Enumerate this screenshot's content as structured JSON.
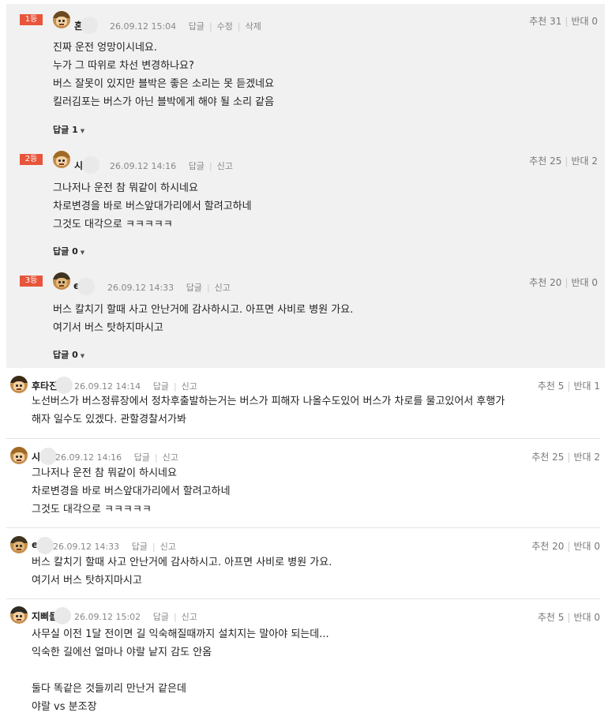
{
  "best_comments": [
    {
      "rank": "1등",
      "nick": "혼",
      "date": "26.09.12 15:04",
      "actions": [
        "답글",
        "수정",
        "삭제"
      ],
      "recommend": "추천 31",
      "oppose": "반대 0",
      "lines": [
        "진짜 운전 엉망이시네요.",
        "누가 그 따위로 차선 변경하나요?",
        "버스 잘못이 있지만 블박은 좋은 소리는 못 듣겠네요",
        "킬러김포는 버스가 아닌 블박에게 해야 될 소리 같음"
      ],
      "reply": "답글 1"
    },
    {
      "rank": "2등",
      "nick": "시",
      "date": "26.09.12 14:16",
      "actions": [
        "답글",
        "신고"
      ],
      "recommend": "추천 25",
      "oppose": "반대 2",
      "lines": [
        "그나저나 운전 참 뭐같이 하시네요",
        "차로변경을 바로 버스앞대가리에서 할려고하네",
        "그것도 대각으로 ㅋㅋㅋㅋㅋ"
      ],
      "reply": "답글 0"
    },
    {
      "rank": "3등",
      "nick": "e",
      "date": "26.09.12 14:33",
      "actions": [
        "답글",
        "신고"
      ],
      "recommend": "추천 20",
      "oppose": "반대 0",
      "lines": [
        "버스 칼치기 할때 사고 안난거에 감사하시고. 아프면 사비로 병원 가요.",
        "여기서 버스 탓하지마시고"
      ],
      "reply": "답글 0"
    }
  ],
  "comments": [
    {
      "nick": "후타진",
      "date": "26.09.12 14:14",
      "actions": [
        "답글",
        "신고"
      ],
      "recommend": "추천 5",
      "oppose": "반대 1",
      "lines": [
        "노선버스가 버스정류장에서 정차후출발하는거는 버스가 피해자 나올수도있어 버스가 차로를 물고있어서 후행가",
        "해자 일수도 있겠다. 관할경찰서가봐"
      ]
    },
    {
      "nick": "시",
      "date": "26.09.12 14:16",
      "actions": [
        "답글",
        "신고"
      ],
      "recommend": "추천 25",
      "oppose": "반대 2",
      "lines": [
        "그나저나 운전 참 뭐같이 하시네요",
        "차로변경을 바로 버스앞대가리에서 할려고하네",
        "그것도 대각으로 ㅋㅋㅋㅋㅋ"
      ]
    },
    {
      "nick": "e",
      "date": "26.09.12 14:33",
      "actions": [
        "답글",
        "신고"
      ],
      "recommend": "추천 20",
      "oppose": "반대 0",
      "lines": [
        "버스 칼치기 할때 사고 안난거에 감사하시고. 아프면 사비로 병원 가요.",
        "여기서 버스 탓하지마시고"
      ]
    },
    {
      "nick": "지삐돌",
      "date": "26.09.12 15:02",
      "actions": [
        "답글",
        "신고"
      ],
      "recommend": "추천 5",
      "oppose": "반대 0",
      "lines": [
        "사무실 이전 1달 전이면 길 익숙해질때까지 설치지는 말아야 되는데...",
        "익숙한 길에선 얼마나 야랄 낱지 감도 안옴",
        "",
        "둘다 똑같은 것들끼리 만난거 같은데",
        "야랄 vs 분조장"
      ]
    }
  ]
}
